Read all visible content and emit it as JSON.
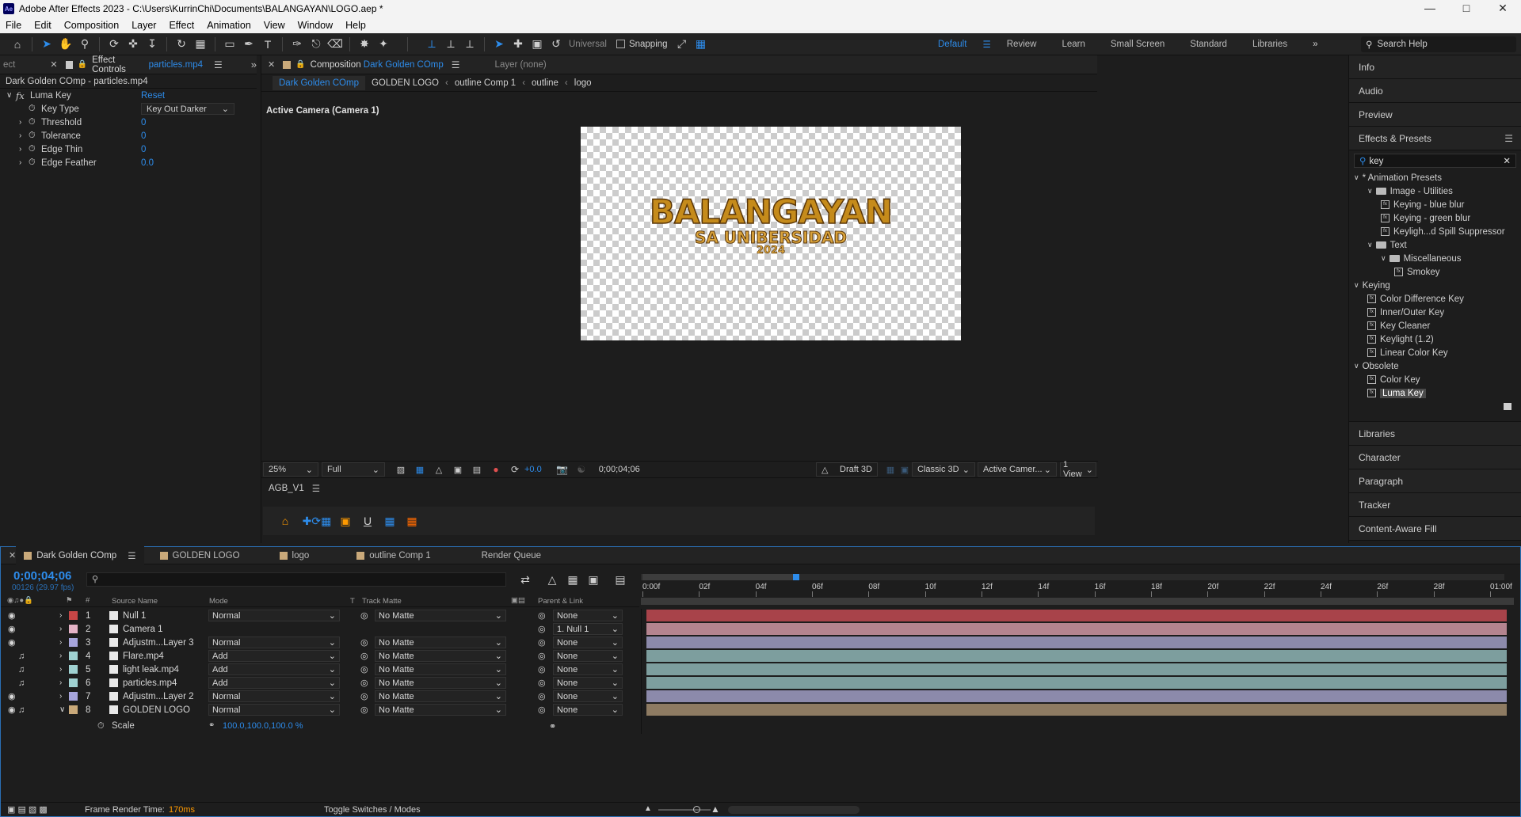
{
  "app": {
    "title": "Adobe After Effects 2023 - C:\\Users\\KurrinChi\\Documents\\BALANGAYAN\\LOGO.aep *",
    "logo": "Ae"
  },
  "menu": [
    "File",
    "Edit",
    "Composition",
    "Layer",
    "Effect",
    "Animation",
    "View",
    "Window",
    "Help"
  ],
  "toolbar": {
    "universal_label": "Universal",
    "snapping_label": "Snapping",
    "workspaces": [
      "Default",
      "Review",
      "Learn",
      "Small Screen",
      "Standard",
      "Libraries"
    ],
    "active_workspace": "Default",
    "search_placeholder": "Search Help"
  },
  "effect_controls": {
    "left_tab_stub": "ect",
    "tab_label": "Effect Controls",
    "tab_file": "particles.mp4",
    "header": "Dark Golden COmp - particles.mp4",
    "effect_name": "Luma Key",
    "reset_label": "Reset",
    "params": [
      {
        "label": "Key Type",
        "value": "Key Out Darker",
        "type": "dropdown"
      },
      {
        "label": "Threshold",
        "value": "0"
      },
      {
        "label": "Tolerance",
        "value": "0"
      },
      {
        "label": "Edge Thin",
        "value": "0"
      },
      {
        "label": "Edge Feather",
        "value": "0.0"
      }
    ]
  },
  "composition": {
    "tab_label": "Composition",
    "tab_comp": "Dark Golden COmp",
    "layer_tab": "Layer (none)",
    "breadcrumbs": [
      "Dark Golden COmp",
      "GOLDEN LOGO",
      "outline Comp 1",
      "outline",
      "logo"
    ],
    "camera_label": "Active Camera (Camera 1)",
    "logo_main": "BALANGAYAN",
    "logo_sub": "SA UNIBERSIDAD",
    "logo_year": "2024",
    "zoom": "25%",
    "resolution": "Full",
    "exposure": "+0.0",
    "timecode": "0;00;04;06",
    "draft3d": "Draft 3D",
    "renderer": "Classic 3D",
    "camera_select": "Active Camer...",
    "view_select": "1 View",
    "lower_panel_title": "AGB_V1"
  },
  "right_panel": {
    "sections_top": [
      "Info",
      "Audio",
      "Preview"
    ],
    "effects_title": "Effects & Presets",
    "search_value": "key",
    "tree": [
      {
        "label": "* Animation Presets",
        "level": 0,
        "kind": "group"
      },
      {
        "label": "Image - Utilities",
        "level": 1,
        "kind": "folder"
      },
      {
        "label": "Keying - blue blur",
        "level": 2,
        "kind": "fx"
      },
      {
        "label": "Keying - green blur",
        "level": 2,
        "kind": "fx"
      },
      {
        "label": "Keyligh...d Spill Suppressor",
        "level": 2,
        "kind": "fx"
      },
      {
        "label": "Text",
        "level": 1,
        "kind": "folder"
      },
      {
        "label": "Miscellaneous",
        "level": 2,
        "kind": "folder"
      },
      {
        "label": "Smokey",
        "level": 3,
        "kind": "fx"
      },
      {
        "label": "Keying",
        "level": 0,
        "kind": "group"
      },
      {
        "label": "Color Difference Key",
        "level": 1,
        "kind": "fx"
      },
      {
        "label": "Inner/Outer Key",
        "level": 1,
        "kind": "fx"
      },
      {
        "label": "Key Cleaner",
        "level": 1,
        "kind": "fx"
      },
      {
        "label": "Keylight (1.2)",
        "level": 1,
        "kind": "fx"
      },
      {
        "label": "Linear Color Key",
        "level": 1,
        "kind": "fx"
      },
      {
        "label": "Obsolete",
        "level": 0,
        "kind": "group"
      },
      {
        "label": "Color Key",
        "level": 1,
        "kind": "fx"
      },
      {
        "label": "Luma Key",
        "level": 1,
        "kind": "fx",
        "selected": true
      }
    ],
    "sections_bottom": [
      "Libraries",
      "Character",
      "Paragraph",
      "Tracker",
      "Content-Aware Fill"
    ]
  },
  "timeline": {
    "tabs": [
      "Dark Golden COmp",
      "GOLDEN LOGO",
      "logo",
      "outline Comp 1",
      "Render Queue"
    ],
    "current_time": "0;00;04;06",
    "frame_info": "00126 (29.97 fps)",
    "columns": {
      "source": "Source Name",
      "mode": "Mode",
      "t": "T",
      "track_matte": "Track Matte",
      "parent": "Parent & Link"
    },
    "ruler": [
      "0:00f",
      "02f",
      "04f",
      "06f",
      "08f",
      "10f",
      "12f",
      "14f",
      "16f",
      "18f",
      "20f",
      "22f",
      "24f",
      "26f",
      "28f",
      "01:00f"
    ],
    "layers": [
      {
        "num": "1",
        "name": "Null 1",
        "mode": "Normal",
        "matte": "No Matte",
        "parent": "None",
        "color": "#c84646",
        "bar": "#a8434a",
        "eye": true,
        "audio": false
      },
      {
        "num": "2",
        "name": "Camera 1",
        "mode": "",
        "matte": "",
        "parent": "1. Null 1",
        "color": "#e5b3c7",
        "bar": "#b4848f",
        "eye": true,
        "audio": false
      },
      {
        "num": "3",
        "name": "Adjustm...Layer 3",
        "mode": "Normal",
        "matte": "No Matte",
        "parent": "None",
        "color": "#a7a5dc",
        "bar": "#8c8aab",
        "eye": true,
        "audio": false
      },
      {
        "num": "4",
        "name": "Flare.mp4",
        "mode": "Add",
        "matte": "No Matte",
        "parent": "None",
        "color": "#9fd1d1",
        "bar": "#7d9e9e",
        "eye": false,
        "audio": true
      },
      {
        "num": "5",
        "name": "light leak.mp4",
        "mode": "Add",
        "matte": "No Matte",
        "parent": "None",
        "color": "#9fd1d1",
        "bar": "#7d9e9e",
        "eye": false,
        "audio": true
      },
      {
        "num": "6",
        "name": "particles.mp4",
        "mode": "Add",
        "matte": "No Matte",
        "parent": "None",
        "color": "#9fd1d1",
        "bar": "#7d9e9e",
        "eye": false,
        "audio": true
      },
      {
        "num": "7",
        "name": "Adjustm...Layer 2",
        "mode": "Normal",
        "matte": "No Matte",
        "parent": "None",
        "color": "#a7a5dc",
        "bar": "#8c8aab",
        "eye": true,
        "audio": false
      },
      {
        "num": "8",
        "name": "GOLDEN LOGO",
        "mode": "Normal",
        "matte": "No Matte",
        "parent": "None",
        "color": "#c9a97a",
        "bar": "#8e7b62",
        "eye": true,
        "audio": true
      }
    ],
    "scale_label": "Scale",
    "scale_value": "100.0,100.0,100.0 %",
    "render_time_label": "Frame Render Time:",
    "render_time_value": "170ms",
    "toggle_label": "Toggle Switches / Modes"
  },
  "colors": {
    "accent": "#2d8ceb",
    "bg": "#1d1d1d",
    "panel": "#232323"
  }
}
